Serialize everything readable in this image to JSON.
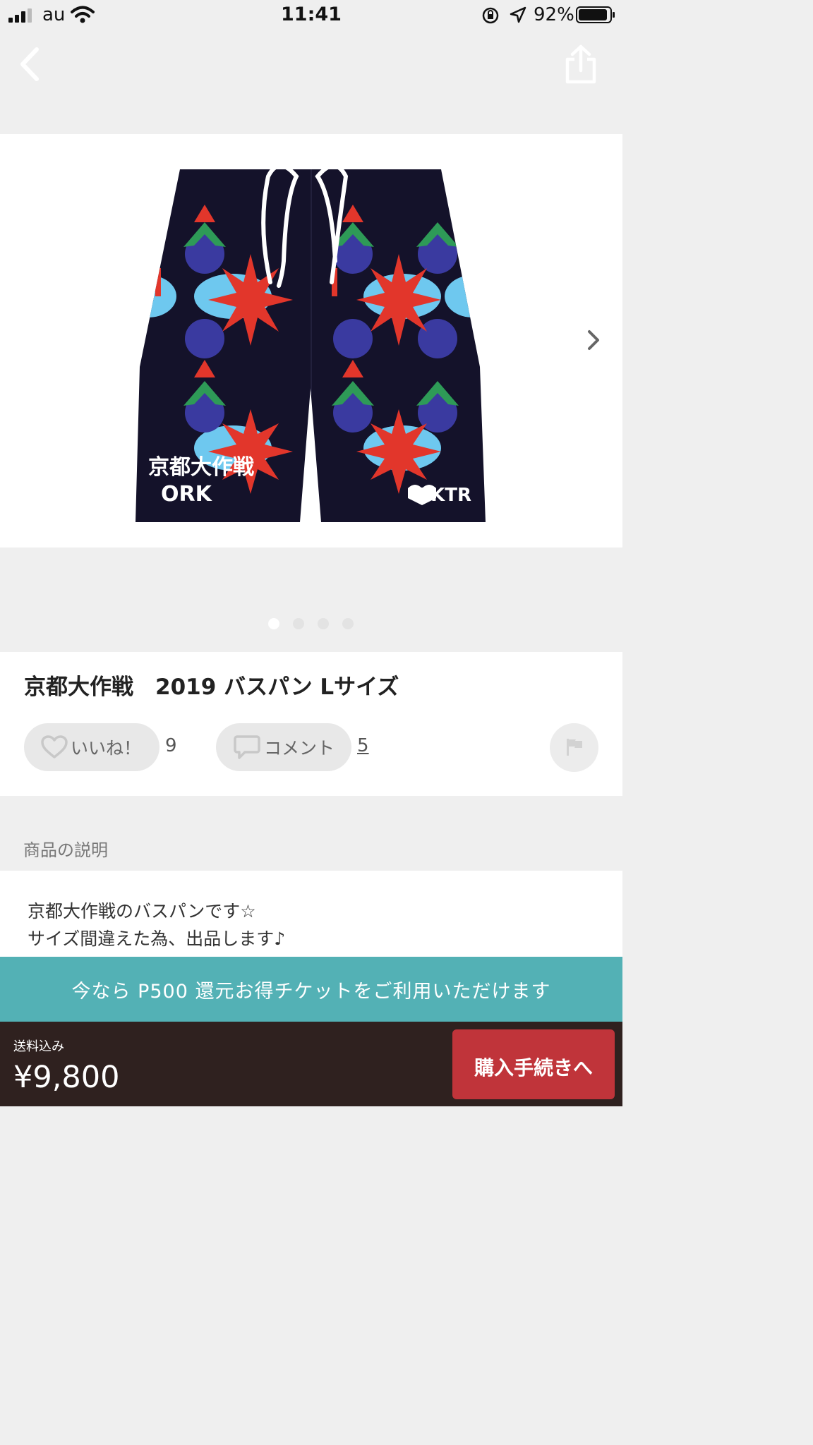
{
  "status_bar": {
    "carrier": "au",
    "time": "11:41",
    "battery_percent": "92%"
  },
  "product": {
    "title": "京都大作戦　2019 バスパン Lサイズ",
    "image_texts": [
      "京都大作戦",
      "ORK",
      "AKTR"
    ],
    "carousel": {
      "total": 4,
      "active_index": 0
    }
  },
  "actions": {
    "like_label": "いいね！",
    "like_count": "9",
    "comment_label": "コメント",
    "comment_count": "5"
  },
  "description": {
    "header": "商品の説明",
    "lines": [
      "京都大作戦のバスパンです☆",
      "サイズ間違えた為、出品します♪"
    ]
  },
  "promo": {
    "text": "今なら P500 還元お得チケットをご利用いただけます"
  },
  "purchase": {
    "shipping_label": "送料込み",
    "price": "¥9,800",
    "buy_label": "購入手続きへ"
  },
  "colors": {
    "promo": "#53b1b5",
    "purchase_bar": "#2f211f",
    "buy_button": "#c0343a"
  },
  "icons": [
    "back-icon",
    "share-icon",
    "chevron-right-icon",
    "heart-icon",
    "comment-icon",
    "flag-icon"
  ]
}
